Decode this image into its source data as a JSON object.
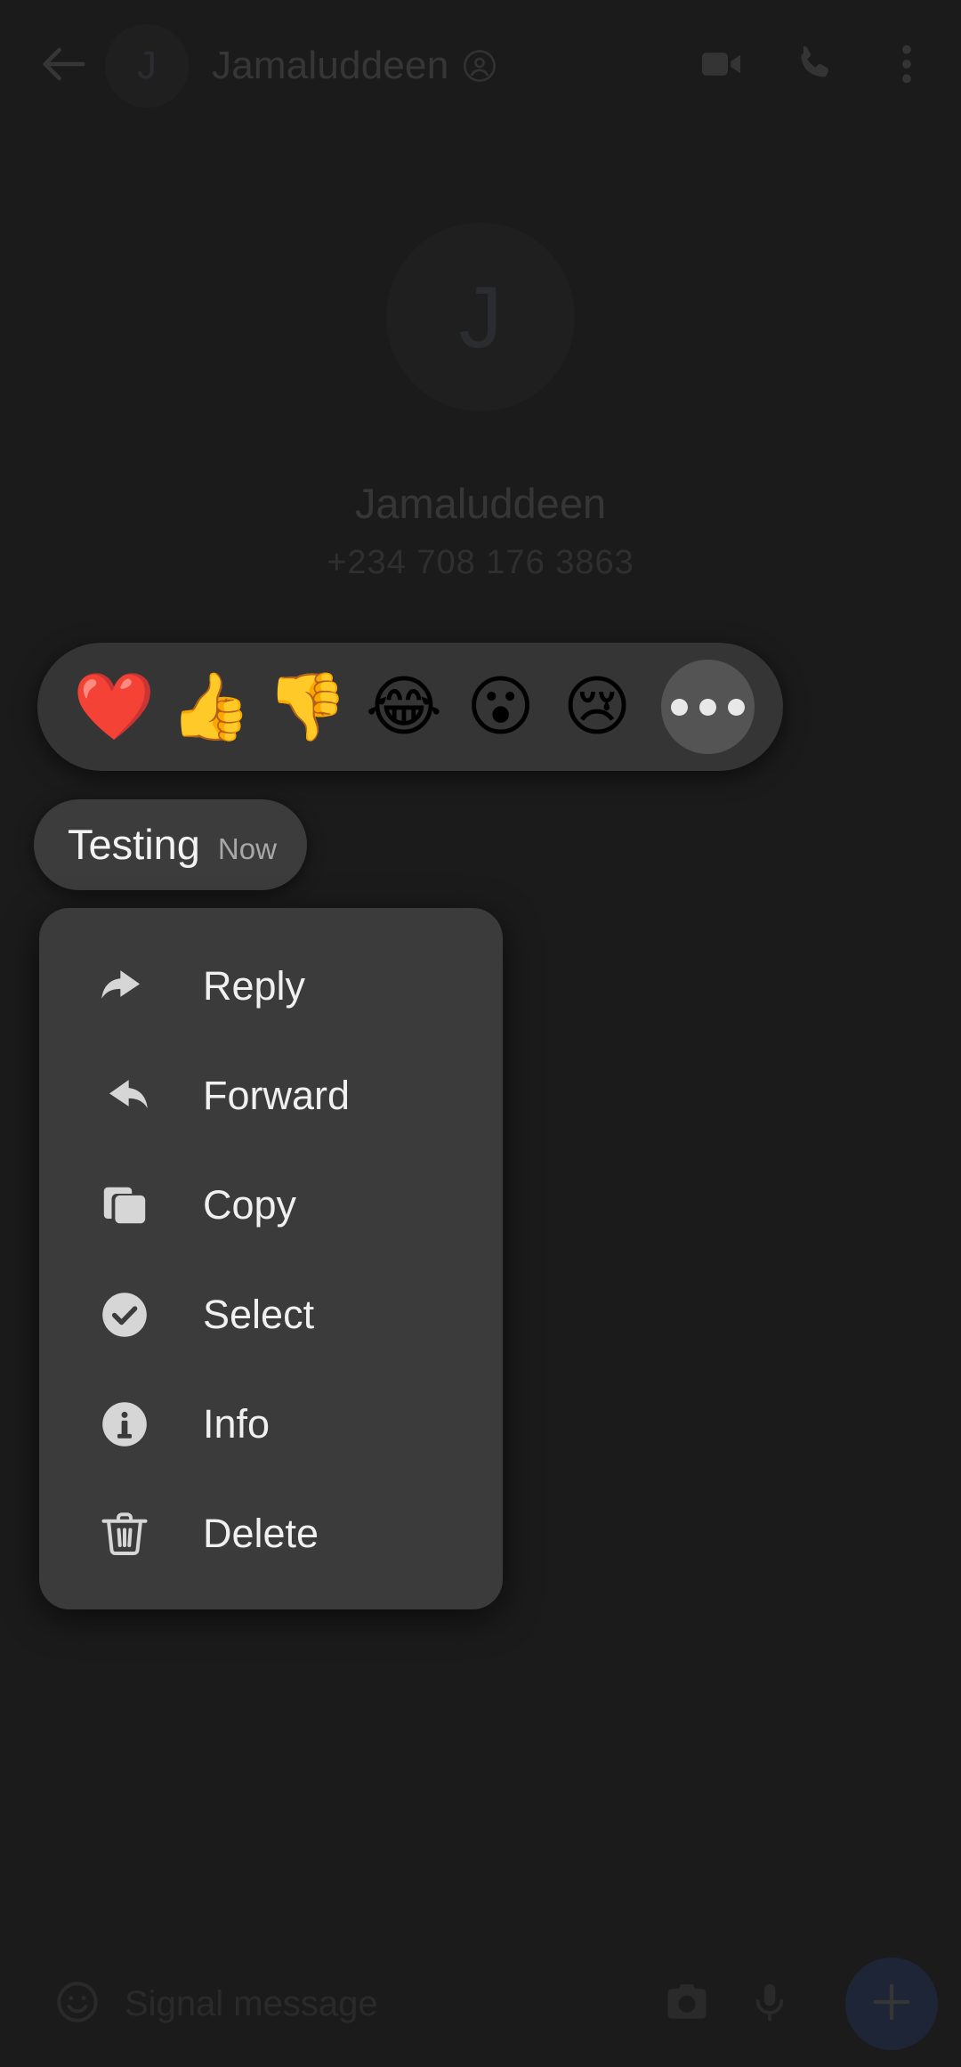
{
  "app": {
    "name": "Signal",
    "theme": "dark",
    "background_color": "#1b1b1b"
  },
  "appbar": {
    "back_icon": "back-arrow-icon",
    "avatar_initial": "J",
    "contact_name": "Jamaluddeen",
    "verified_icon": "contact-badge-icon",
    "actions": [
      {
        "name": "video-call-button",
        "icon": "video-camera-icon"
      },
      {
        "name": "voice-call-button",
        "icon": "phone-icon"
      },
      {
        "name": "overflow-menu-button",
        "icon": "three-dots-vertical-icon"
      }
    ]
  },
  "profile": {
    "avatar_initial": "J",
    "name": "Jamaluddeen",
    "phone": "+234 708 176 3863"
  },
  "reaction_bar": {
    "emojis": [
      {
        "name": "reaction-heart",
        "glyph": "❤️",
        "label": "heart"
      },
      {
        "name": "reaction-thumbs-up",
        "glyph": "👍",
        "label": "thumbs up"
      },
      {
        "name": "reaction-thumbs-down",
        "glyph": "👎",
        "label": "thumbs down"
      },
      {
        "name": "reaction-joy",
        "glyph": "😂",
        "label": "face with tears of joy"
      },
      {
        "name": "reaction-surprised",
        "glyph": "😮",
        "label": "face with open mouth"
      },
      {
        "name": "reaction-sad",
        "glyph": "😢",
        "label": "crying face"
      }
    ],
    "more_button_label": "More reactions",
    "background_color": "#353535",
    "more_button_color": "#545454"
  },
  "message": {
    "text": "Testing",
    "timestamp": "Now",
    "bubble_color": "#3c3c3c"
  },
  "context_menu": {
    "background_color": "#3b3b3b",
    "items": [
      {
        "label": "Reply",
        "icon": "reply-arrow-icon"
      },
      {
        "label": "Forward",
        "icon": "forward-arrow-icon"
      },
      {
        "label": "Copy",
        "icon": "copy-icon"
      },
      {
        "label": "Select",
        "icon": "check-circle-icon"
      },
      {
        "label": "Info",
        "icon": "info-circle-icon"
      },
      {
        "label": "Delete",
        "icon": "trash-icon"
      }
    ]
  },
  "compose": {
    "placeholder": "Signal message",
    "emoji_icon": "smiley-face-icon",
    "camera_icon": "camera-icon",
    "mic_icon": "microphone-icon",
    "add_icon": "plus-icon",
    "add_button_color": "#2c6bed"
  }
}
